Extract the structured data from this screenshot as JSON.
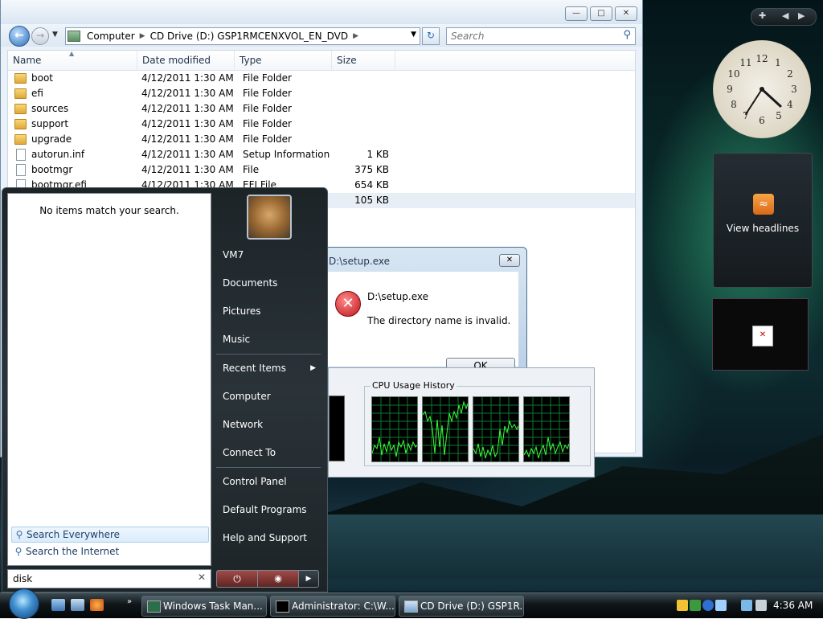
{
  "explorer": {
    "address_crumbs": [
      "Computer",
      "CD Drive (D:) GSP1RMCENXVOL_EN_DVD"
    ],
    "search_placeholder": "Search",
    "columns": [
      "Name",
      "Date modified",
      "Type",
      "Size"
    ],
    "rows": [
      {
        "name": "boot",
        "date": "4/12/2011 1:30 AM",
        "type": "File Folder",
        "size": "",
        "icon": "folder-icon"
      },
      {
        "name": "efi",
        "date": "4/12/2011 1:30 AM",
        "type": "File Folder",
        "size": "",
        "icon": "folder-icon"
      },
      {
        "name": "sources",
        "date": "4/12/2011 1:30 AM",
        "type": "File Folder",
        "size": "",
        "icon": "folder-icon"
      },
      {
        "name": "support",
        "date": "4/12/2011 1:30 AM",
        "type": "File Folder",
        "size": "",
        "icon": "folder-icon"
      },
      {
        "name": "upgrade",
        "date": "4/12/2011 1:30 AM",
        "type": "File Folder",
        "size": "",
        "icon": "folder-icon"
      },
      {
        "name": "autorun.inf",
        "date": "4/12/2011 1:30 AM",
        "type": "Setup Information",
        "size": "1 KB",
        "icon": "setup-info-icon"
      },
      {
        "name": "bootmgr",
        "date": "4/12/2011 1:30 AM",
        "type": "File",
        "size": "375 KB",
        "icon": "file-icon"
      },
      {
        "name": "bootmgr.efi",
        "date": "4/12/2011 1:30 AM",
        "type": "EFI File",
        "size": "654 KB",
        "icon": "file-icon"
      },
      {
        "name": "",
        "date": "",
        "type": "",
        "size": "105 KB",
        "icon": "file-icon"
      }
    ]
  },
  "error_dialog": {
    "title": "D:\\setup.exe",
    "path": "D:\\setup.exe",
    "message": "The directory name is invalid.",
    "ok_label": "OK"
  },
  "task_manager": {
    "cpu_history_label": "CPU Usage History"
  },
  "start_menu": {
    "no_items": "No items match your search.",
    "search_everywhere": "Search Everywhere",
    "search_internet": "Search the Internet",
    "search_value": "disk",
    "right_items": [
      {
        "label": "VM7"
      },
      {
        "label": "Documents"
      },
      {
        "label": "Pictures"
      },
      {
        "label": "Music"
      },
      {
        "label": "Recent Items"
      },
      {
        "label": "Computer"
      },
      {
        "label": "Network"
      },
      {
        "label": "Connect To"
      },
      {
        "label": "Control Panel"
      },
      {
        "label": "Default Programs"
      },
      {
        "label": "Help and Support"
      }
    ]
  },
  "gadgets": {
    "rss_label": "View headlines",
    "clock_numbers": [
      "12",
      "1",
      "2",
      "3",
      "4",
      "5",
      "6",
      "7",
      "8",
      "9",
      "10",
      "11"
    ]
  },
  "taskbar": {
    "buttons": [
      {
        "label": "Windows Task Man..."
      },
      {
        "label": "Administrator: C:\\W..."
      },
      {
        "label": "CD Drive (D:) GSP1R..."
      }
    ],
    "time": "4:36 AM"
  },
  "colors": {
    "taskbar_bg": "#0f1518",
    "accent": "#3f8fd0",
    "cpu_line": "#3cff3c",
    "cpu_grid": "#0e7a2c"
  }
}
